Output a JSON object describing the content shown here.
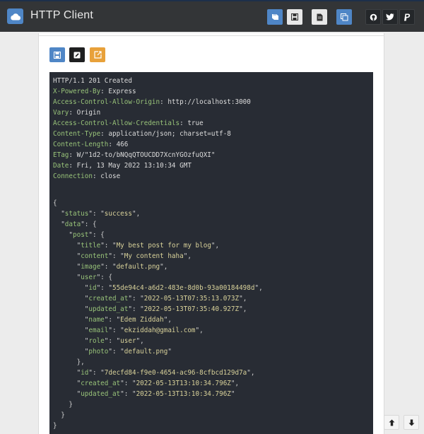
{
  "app": {
    "title": "HTTP Client"
  },
  "toolbar_icons": [
    "book-icon",
    "save-icon",
    "file-icon",
    "copy-icon",
    "github-icon",
    "twitter-icon",
    "paypal-icon"
  ],
  "actions_icons": [
    "save-icon",
    "edit-icon",
    "external-link-icon"
  ],
  "response": {
    "status_line": "HTTP/1.1 201 Created",
    "headers": [
      {
        "name": "X-Powered-By",
        "value": "Express"
      },
      {
        "name": "Access-Control-Allow-Origin",
        "value": "http://localhost:3000"
      },
      {
        "name": "Vary",
        "value": "Origin"
      },
      {
        "name": "Access-Control-Allow-Credentials",
        "value": "true"
      },
      {
        "name": "Content-Type",
        "value": "application/json; charset=utf-8"
      },
      {
        "name": "Content-Length",
        "value": "466"
      },
      {
        "name": "ETag",
        "value": "W/\"1d2-to/bNQqQTOUCDD7XcnYGOzfuQXI\""
      },
      {
        "name": "Date",
        "value": "Fri, 13 May 2022 13:10:34 GMT"
      },
      {
        "name": "Connection",
        "value": "close"
      }
    ],
    "body": {
      "status": "success",
      "post_title": "My best post for my blog",
      "post_content": "My content haha",
      "post_image": "default.png",
      "user_id": "55de94c4-a6d2-483e-8d0b-93a00184498d",
      "user_created_at": "2022-05-13T07:35:13.073Z",
      "user_updated_at": "2022-05-13T07:35:40.927Z",
      "user_name": "Edem Ziddah",
      "user_email": "ekziddah@gmail.com",
      "user_role": "user",
      "user_photo": "default.png",
      "post_id": "7decfd84-f9e0-4654-ac96-8cfbcd129d7a",
      "post_created_at": "2022-05-13T13:10:34.796Z",
      "post_updated_at": "2022-05-13T13:10:34.796Z"
    }
  },
  "colors": {
    "topbar": "#333537",
    "accent_blue": "#4f86c6",
    "editor_bg": "#282c34",
    "key_green": "#98c379",
    "string_yellow": "#d9d29a",
    "orange": "#e8a13a"
  }
}
